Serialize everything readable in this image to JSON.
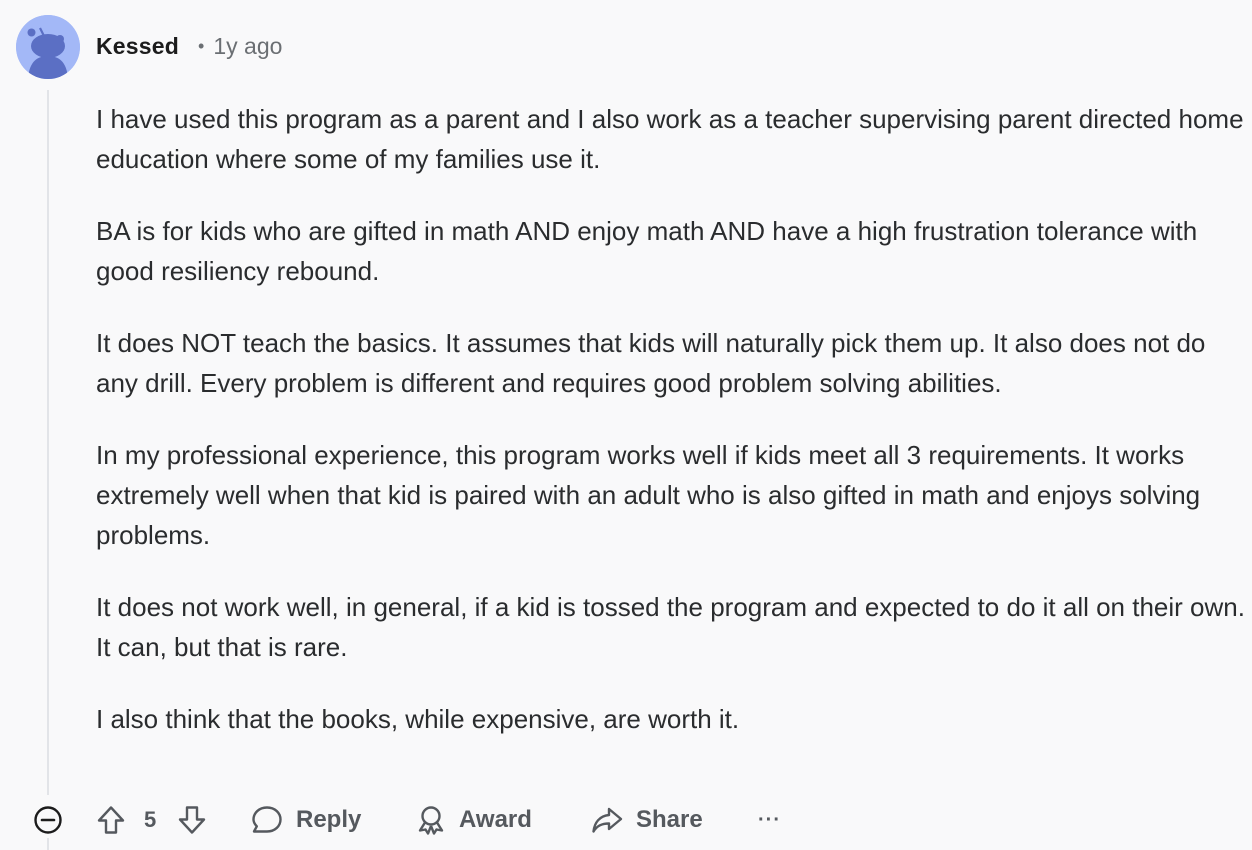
{
  "comment": {
    "author": "Kessed",
    "separator": "•",
    "time": "1y ago",
    "paragraphs": [
      "I have used this program as a parent and I also work as a teacher supervising parent directed home education where some of my families use it.",
      "BA is for kids who are gifted in math AND enjoy math AND have a high frustration tolerance with good resiliency rebound.",
      "It does NOT teach the basics. It assumes that kids will naturally pick them up. It also does not do any drill. Every problem is different and requires good problem solving abilities.",
      "In my professional experience, this program works well if kids meet all 3 requirements. It works extremely well when that kid is paired with an adult who is also gifted in math and enjoys solving problems.",
      "It does not work well, in general, if a kid is tossed the program and expected to do it all on their own. It can, but that is rare.",
      "I also think that the books, while expensive, are worth it."
    ]
  },
  "actions": {
    "score": "5",
    "reply_label": "Reply",
    "award_label": "Award",
    "share_label": "Share",
    "more_label": "···"
  },
  "icons": {
    "collapse": "minus-circle-icon",
    "upvote": "arrow-up-icon",
    "downvote": "arrow-down-icon",
    "reply": "speech-bubble-icon",
    "award": "award-ribbon-icon",
    "share": "share-arrow-icon"
  },
  "colors": {
    "background": "#f9f9fa",
    "avatar": "#a3b8f7",
    "avatar_figure": "#5b6fc4",
    "text": "#2a2c2e",
    "muted": "#55595e",
    "thread_line": "#e2e4e8"
  }
}
